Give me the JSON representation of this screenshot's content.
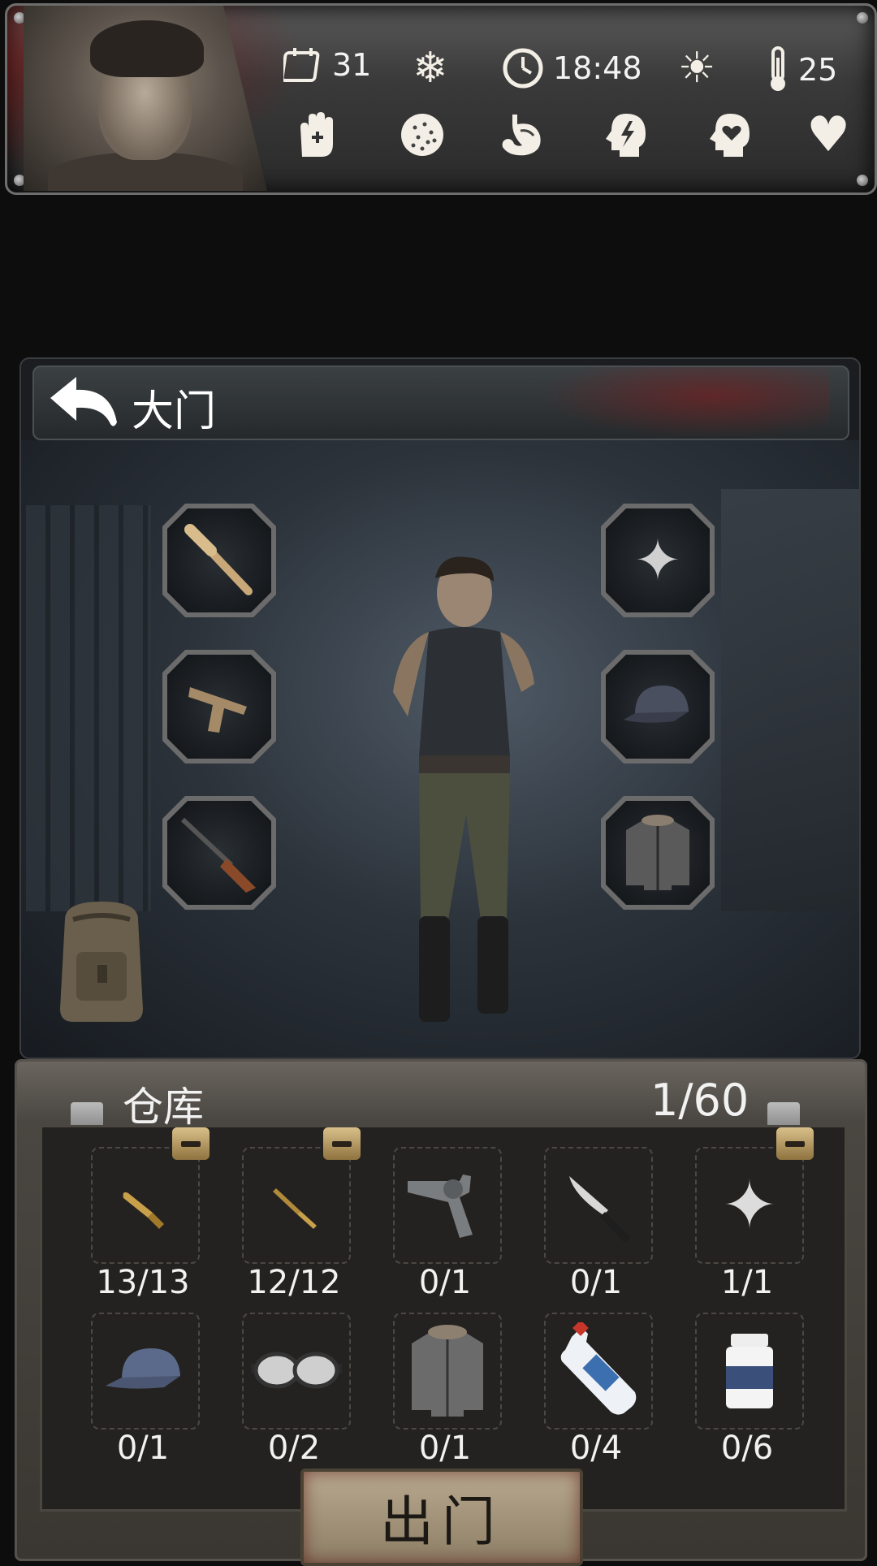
{
  "hud": {
    "day": "31",
    "time": "18:48",
    "temperature": "25",
    "icons": [
      "calendar-icon",
      "snowflake-icon",
      "clock-icon",
      "sun-icon",
      "thermometer-icon",
      "hand-icon",
      "virus-icon",
      "stomach-icon",
      "energy-head-icon",
      "mood-head-icon",
      "heart-icon"
    ]
  },
  "location": {
    "back_label": "↶",
    "title": "大门"
  },
  "equipment": {
    "left": [
      "baseball-bat",
      "pistol",
      "rifle"
    ],
    "right": [
      "shuriken",
      "cap",
      "winter-jacket"
    ]
  },
  "warehouse": {
    "title": "仓库",
    "capacity": "1/60",
    "items": [
      {
        "name": "pistol-ammo",
        "count": "13/13",
        "has_minus": true
      },
      {
        "name": "rifle-ammo",
        "count": "12/12",
        "has_minus": true
      },
      {
        "name": "revolver",
        "count": "0/1",
        "has_minus": false
      },
      {
        "name": "knife",
        "count": "0/1",
        "has_minus": false
      },
      {
        "name": "shuriken",
        "count": "1/1",
        "has_minus": true
      },
      {
        "name": "cap",
        "count": "0/1",
        "has_minus": false
      },
      {
        "name": "goggles",
        "count": "0/2",
        "has_minus": false
      },
      {
        "name": "winter-jacket",
        "count": "0/1",
        "has_minus": false
      },
      {
        "name": "alcohol-bottle",
        "count": "0/4",
        "has_minus": false
      },
      {
        "name": "pill-bottle",
        "count": "0/6",
        "has_minus": false
      }
    ]
  },
  "go_out_label": "出门",
  "colors": {
    "accent": "#d9c08a",
    "text": "#f2f2f2",
    "blood": "#8c0a0a"
  }
}
